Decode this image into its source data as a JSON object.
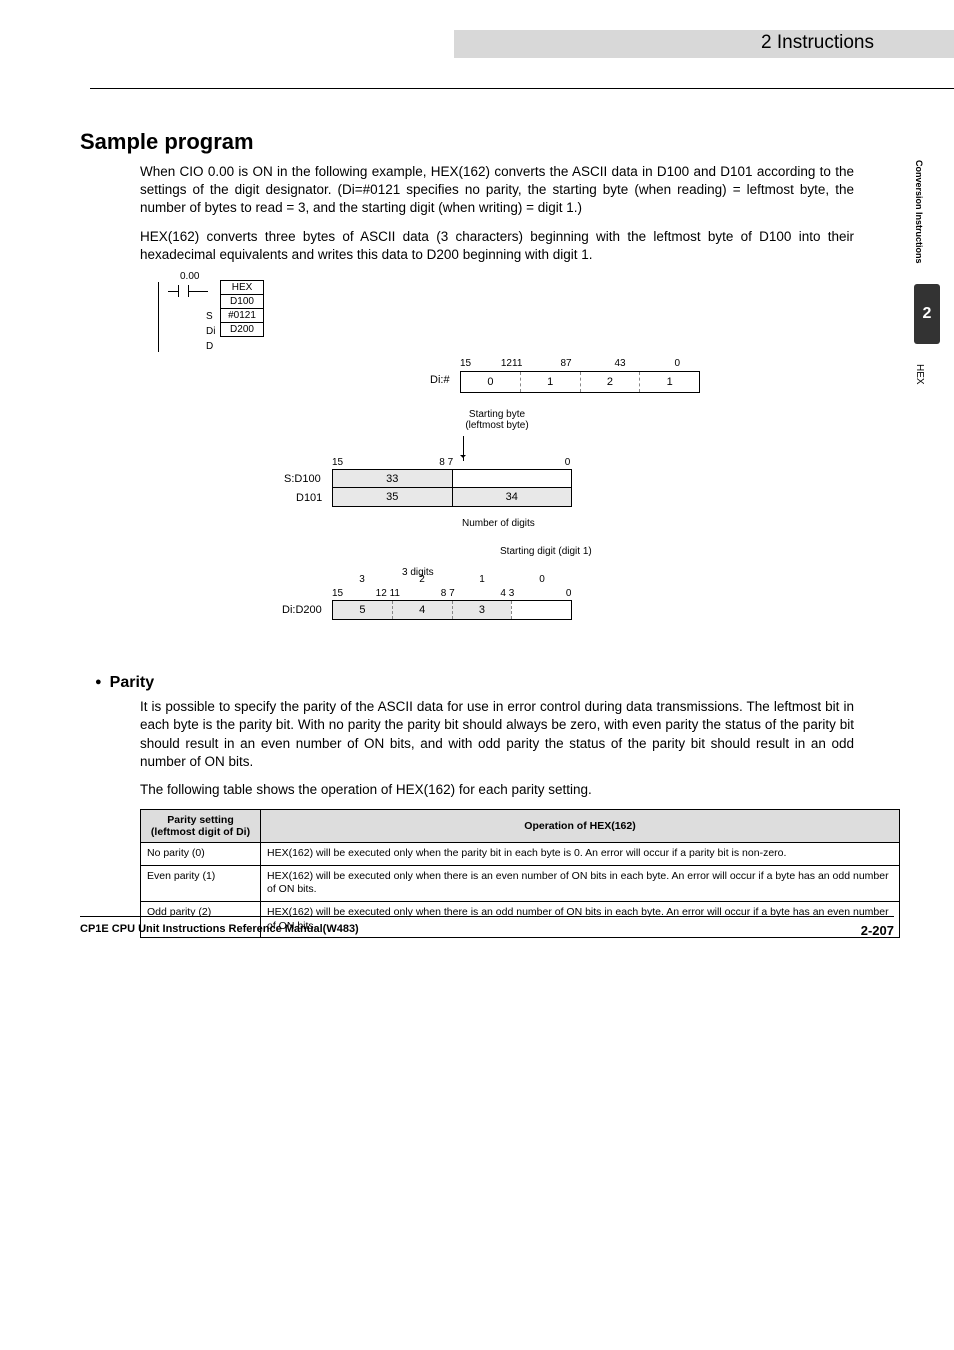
{
  "header": {
    "section": "2  Instructions"
  },
  "sidebar": {
    "vtext_top": "Conversion Instructions",
    "chapter_num": "2",
    "vtext_bottom": "HEX"
  },
  "section": {
    "title": "Sample program",
    "para1": "When CIO 0.00 is ON in the following example, HEX(162) converts the ASCII data in D100 and D101 according to the settings of the digit designator. (Di=#0121 specifies no parity, the starting byte (when reading) = leftmost byte, the number of bytes to read = 3, and the starting digit (when writing) = digit 1.)",
    "para2": "HEX(162) converts three bytes of ASCII data (3 characters) beginning with the leftmost byte of D100 into their hexadecimal equivalents and writes this data to D200 beginning with digit 1."
  },
  "ladder": {
    "contact": "0.00",
    "rows": [
      "HEX",
      "D100",
      "#0121",
      "D200"
    ],
    "row_labels": [
      "",
      "S",
      "Di",
      "D"
    ]
  },
  "di_box": {
    "label": "Di:#",
    "bits": [
      "15",
      "12",
      "11",
      "8",
      "7",
      "4",
      "3",
      "0"
    ],
    "cells": [
      "0",
      "1",
      "2",
      "1"
    ]
  },
  "labels": {
    "starting_byte": "Starting byte\n(leftmost byte)",
    "number_of_digits": "Number of digits",
    "starting_digit": "Starting digit (digit 1)",
    "three_digits": "3 digits"
  },
  "source_words": {
    "label1": "S:D100",
    "label2": "D101",
    "bits": [
      "15",
      "8",
      "7",
      "0"
    ],
    "row1": [
      "33",
      ""
    ],
    "row2": [
      "35",
      "34"
    ]
  },
  "dest_word": {
    "label": "Di:D200",
    "top_nums": [
      "3",
      "2",
      "1",
      "0"
    ],
    "bits": [
      "15",
      "12",
      "11",
      "8",
      "7",
      "4",
      "3",
      "0"
    ],
    "cells": [
      "5",
      "4",
      "3",
      ""
    ]
  },
  "parity": {
    "title": "Parity",
    "para1": "It is possible to specify the parity of the ASCII data for use in error control during data transmissions. The leftmost bit in each byte is the parity bit. With no parity the parity bit should always be zero, with even parity the status of the parity bit should result in an even number of ON bits, and with odd parity the status of the parity bit should result in an odd number of ON bits.",
    "para2": "The following table shows the operation of HEX(162) for each parity setting.",
    "table": {
      "headers": [
        "Parity setting\n(leftmost digit of Di)",
        "Operation of HEX(162)"
      ],
      "rows": [
        {
          "setting": "No parity (0)",
          "op": "HEX(162) will be executed only when the parity bit in each byte is 0. An error will occur if a parity bit is non-zero."
        },
        {
          "setting": "Even parity (1)",
          "op": "HEX(162) will be executed only when there is an even number of ON bits in each byte. An error will occur if a byte has an odd number of ON bits."
        },
        {
          "setting": "Odd parity (2)",
          "op": "HEX(162) will be executed only when there is an odd number of ON bits in each byte. An error will occur if a byte has an even number of ON bits."
        }
      ]
    }
  },
  "footer": {
    "left": "CP1E CPU Unit Instructions Reference Manual(W483)",
    "right": "2-207"
  }
}
